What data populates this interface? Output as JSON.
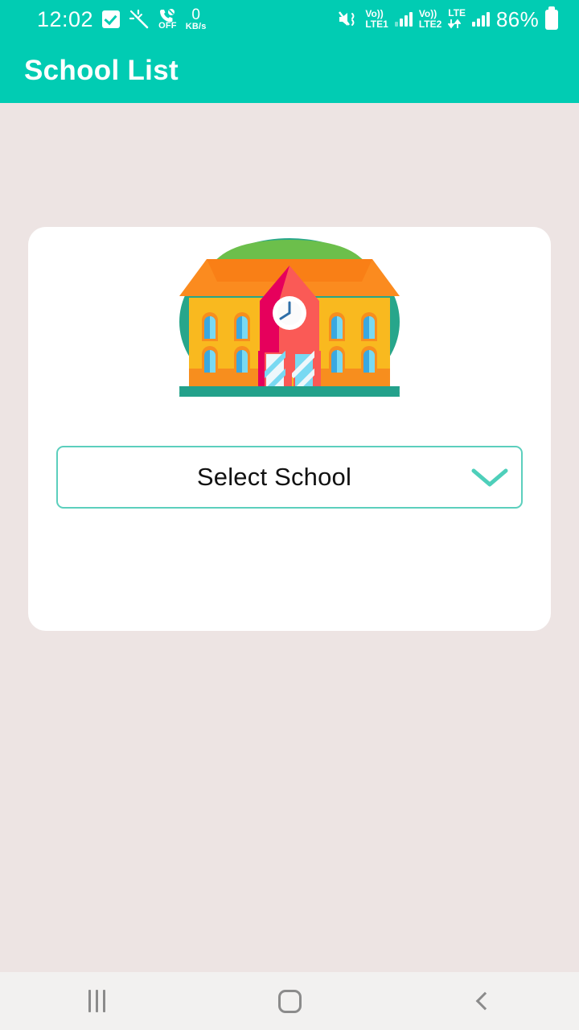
{
  "status_bar": {
    "time": "12:02",
    "icons": [
      {
        "name": "checkbox-icon",
        "label": ""
      },
      {
        "name": "magic-wand-icon",
        "label": ""
      },
      {
        "name": "call-off-icon",
        "label": "OFF"
      },
      {
        "name": "network-speed-icon",
        "value": "0",
        "unit": "KB/s"
      }
    ],
    "right": {
      "mute_icon": "mute-vibrate-icon",
      "sim1": {
        "volte": "Vo))",
        "network": "LTE1"
      },
      "sim2": {
        "volte": "Vo))",
        "network": "LTE2",
        "data": "LTE"
      },
      "battery_percent": "86%",
      "battery_icon": "battery-full-icon"
    }
  },
  "app_bar": {
    "title": "School List"
  },
  "card": {
    "illustration": {
      "name": "school-building-illustration",
      "alt": "school building with clock tower"
    },
    "dropdown": {
      "label": "Select School",
      "placeholder": "Select School",
      "chevron_icon": "chevron-down-icon",
      "expanded": false,
      "options": []
    }
  },
  "nav_bar": {
    "recents_label": "Recents",
    "home_label": "Home",
    "back_label": "Back"
  },
  "colors": {
    "accent_teal": "#01ccb3",
    "page_background": "#ede4e3",
    "card_background": "#ffffff",
    "dropdown_border": "#5ccfbd",
    "chevron": "#4ecfba",
    "nav_background": "#f2f1f0"
  }
}
